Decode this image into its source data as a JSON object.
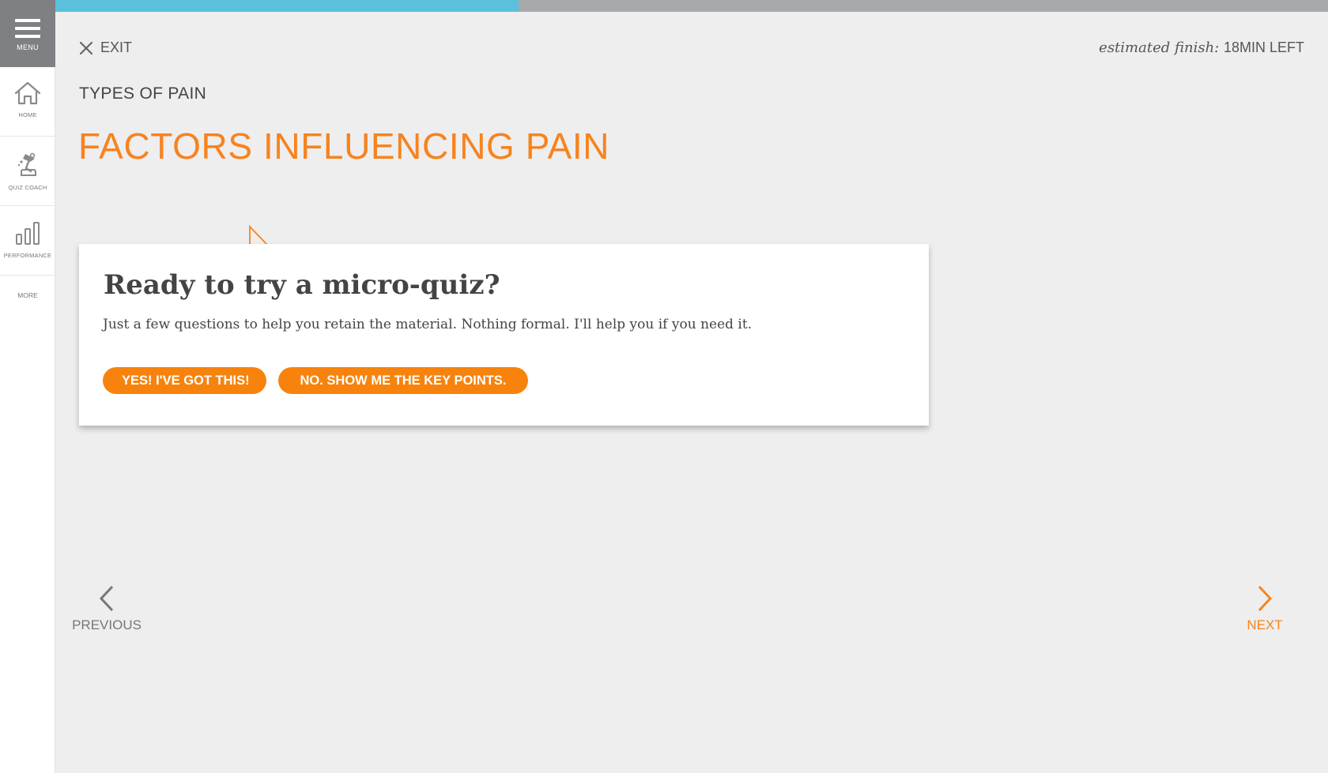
{
  "sidebar": {
    "menu_label": "MENU",
    "items": [
      {
        "label": "HOME",
        "icon": "home-icon"
      },
      {
        "label": "QUIZ COACH",
        "icon": "quiz-coach-icon"
      },
      {
        "label": "PERFORMANCE",
        "icon": "performance-icon"
      }
    ],
    "more_label": "MORE"
  },
  "progress": {
    "fraction": 0.364,
    "fill_color": "#5bc0de",
    "track_color": "#a7a9ab"
  },
  "header": {
    "exit_label": "EXIT",
    "finish_label": "estimated finish:",
    "finish_value": "18MIN LEFT"
  },
  "lesson": {
    "section": "TYPES OF PAIN",
    "title": "FACTORS INFLUENCING PAIN"
  },
  "quiz_card": {
    "heading": "Ready to try a micro-quiz?",
    "body": "Just a few questions to help you retain the material. Nothing formal. I'll help you if you need it.",
    "yes_label": "YES! I'VE GOT THIS!",
    "no_label": "NO. SHOW ME THE KEY POINTS."
  },
  "nav": {
    "previous_label": "PREVIOUS",
    "next_label": "NEXT"
  },
  "colors": {
    "accent": "#f7831f",
    "background": "#eeeeee",
    "text": "#444444"
  }
}
